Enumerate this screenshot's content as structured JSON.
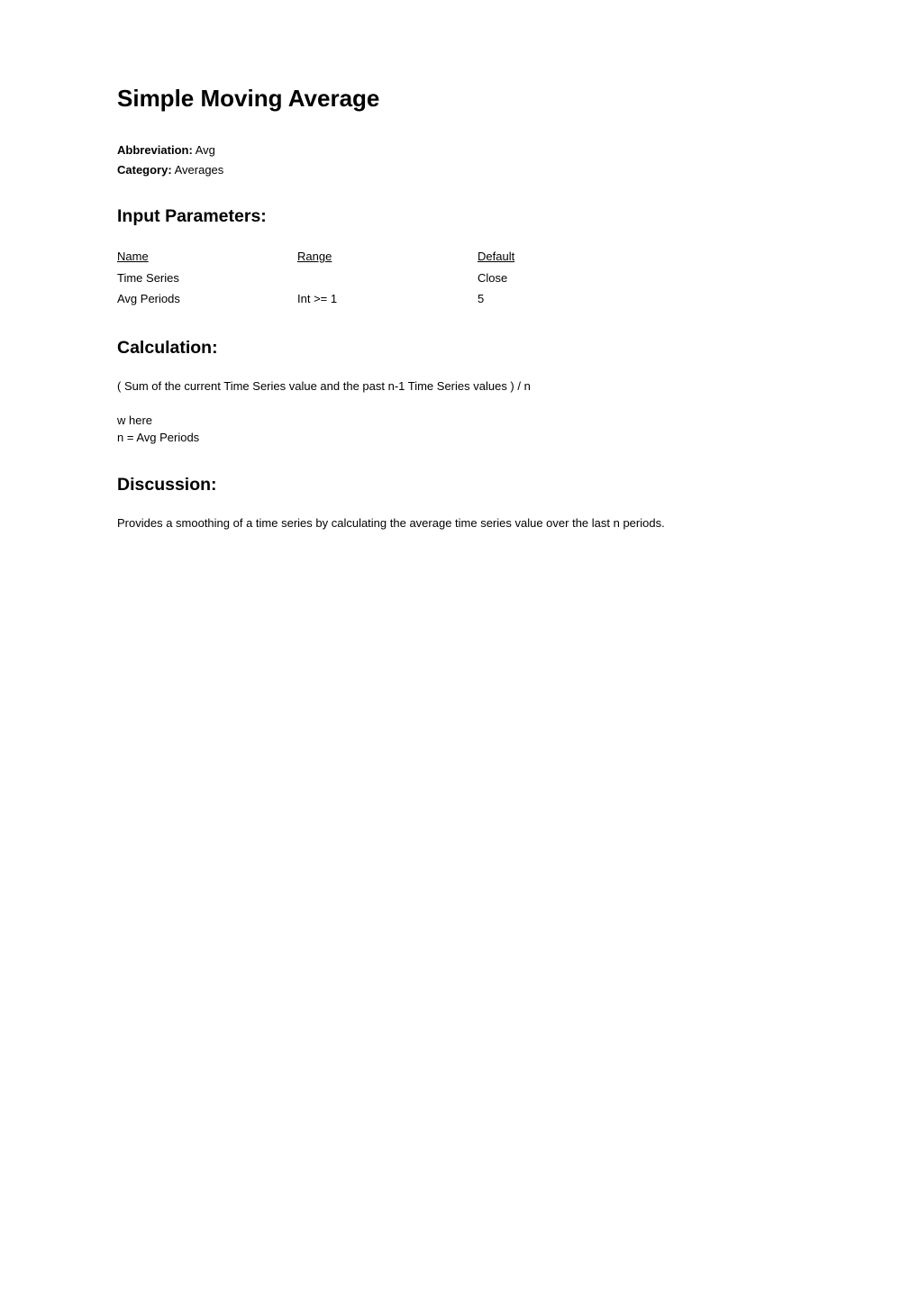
{
  "title": "Simple Moving Average",
  "meta": {
    "abbreviation_label": "Abbreviation:",
    "abbreviation_value": "Avg",
    "category_label": "Category:",
    "category_value": "Averages"
  },
  "input_params": {
    "heading": "Input Parameters:",
    "headers": {
      "name": "Name",
      "range": "Range",
      "default": "Default"
    },
    "rows": [
      {
        "name": "Time Series",
        "range": "",
        "default": "Close"
      },
      {
        "name": "Avg Periods",
        "range": "Int >= 1",
        "default": "5"
      }
    ]
  },
  "calculation": {
    "heading": "Calculation:",
    "formula": "( Sum of the current Time Series value and the past n-1 Time Series values )  /  n",
    "where_label": "w here",
    "where_defs": "n = Avg Periods"
  },
  "discussion": {
    "heading": "Discussion:",
    "text": "Provides a smoothing of a time series by calculating the average time series value over the last n periods."
  }
}
